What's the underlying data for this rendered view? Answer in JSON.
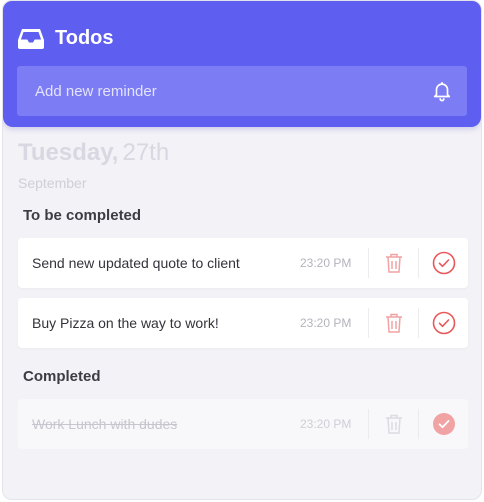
{
  "header": {
    "title": "Todos",
    "icon": "inbox-icon",
    "background": "#5e5ef0"
  },
  "new_reminder": {
    "placeholder": "Add new reminder",
    "icon": "bell-icon"
  },
  "date": {
    "weekday": "Tuesday,",
    "day": "27th",
    "month": "September"
  },
  "sections": {
    "pending": {
      "title": "To be completed",
      "items": [
        {
          "text": "Send new updated quote to client",
          "time": "23:20 PM"
        },
        {
          "text": "Buy Pizza on the way to work!",
          "time": "23:20 PM"
        }
      ]
    },
    "completed": {
      "title": "Completed",
      "items": [
        {
          "text": "Work Lunch with dudes",
          "time": "23:20 PM"
        }
      ]
    }
  },
  "colors": {
    "accent": "#5e5ef0",
    "action_red": "#e8585a",
    "done_check": "#f1a3a4"
  }
}
